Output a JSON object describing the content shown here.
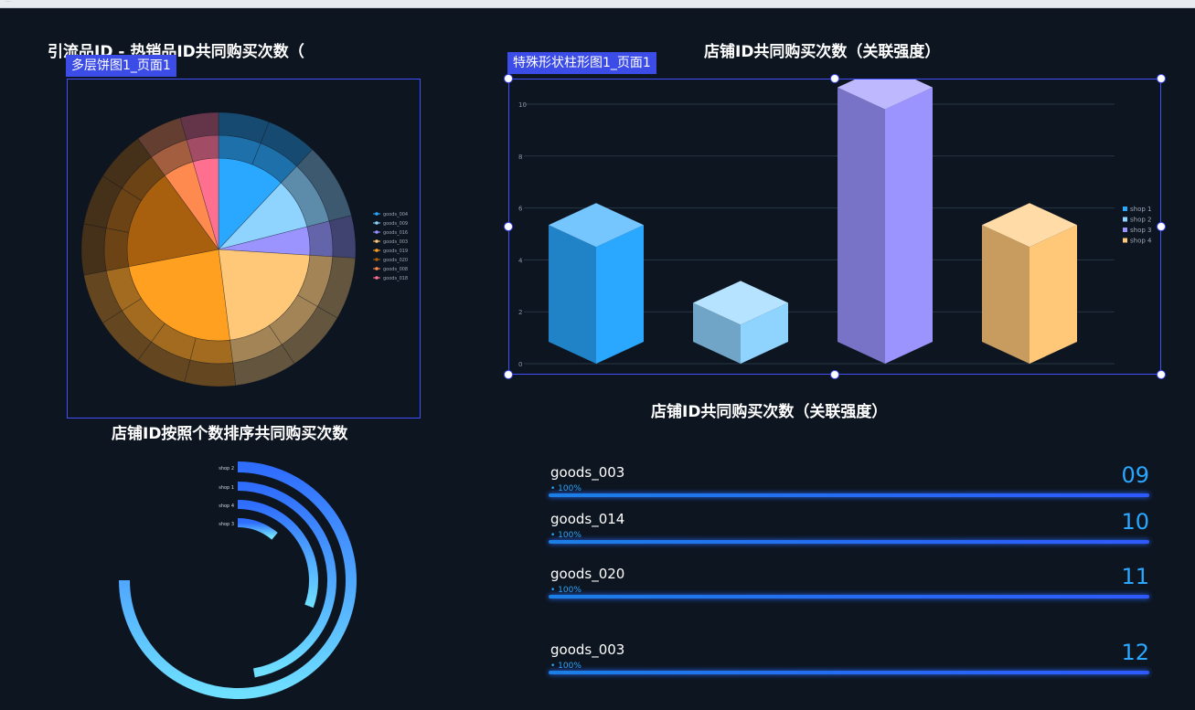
{
  "titles": {
    "pie": "引流品ID - 热销品ID共同购买次数（",
    "bar": "店铺ID共同购买次数（关联强度）",
    "radial": "店铺ID按照个数排序共同购买次数",
    "kpi": "店铺ID共同购买次数（关联强度）"
  },
  "tags": {
    "pie": "多层饼图1_页面1",
    "bar": "特殊形状柱形图1_页面1"
  },
  "chart_data": [
    {
      "type": "pie",
      "legend": [
        "goods_004",
        "goods_009",
        "goods_016",
        "goods_003",
        "goods_019",
        "goods_020",
        "goods_008",
        "goods_018"
      ],
      "legend_position": "right",
      "values": [
        12,
        9,
        5,
        22,
        24,
        18,
        10
      ],
      "colors": [
        "#2aa8ff",
        "#8fd4ff",
        "#9b94ff",
        "#ffc878",
        "#ffa020",
        "#a8600e",
        "#ff8a50",
        "#ff7090"
      ]
    },
    {
      "type": "bar",
      "categories": [
        "shop 1",
        "shop 2",
        "shop 3",
        "shop 4"
      ],
      "values": [
        4.5,
        1.5,
        9.8,
        4.5
      ],
      "ylim": [
        0,
        10
      ],
      "yticks": [
        0,
        2,
        4,
        6,
        8,
        10
      ],
      "colors": [
        "#2aa8ff",
        "#8fd4ff",
        "#9b94ff",
        "#ffc878"
      ],
      "legend_position": "right"
    },
    {
      "type": "bar",
      "categories": [
        "shop 2",
        "shop 1",
        "shop 4",
        "shop 3"
      ],
      "values": [
        270,
        170,
        110,
        40
      ]
    }
  ],
  "kpis": [
    {
      "name": "goods_003",
      "pct": "• 100%",
      "num": "09"
    },
    {
      "name": "goods_014",
      "pct": "• 100%",
      "num": "10"
    },
    {
      "name": "goods_020",
      "pct": "• 100%",
      "num": "11"
    },
    {
      "name": "goods_003",
      "pct": "• 100%",
      "num": "12"
    }
  ]
}
